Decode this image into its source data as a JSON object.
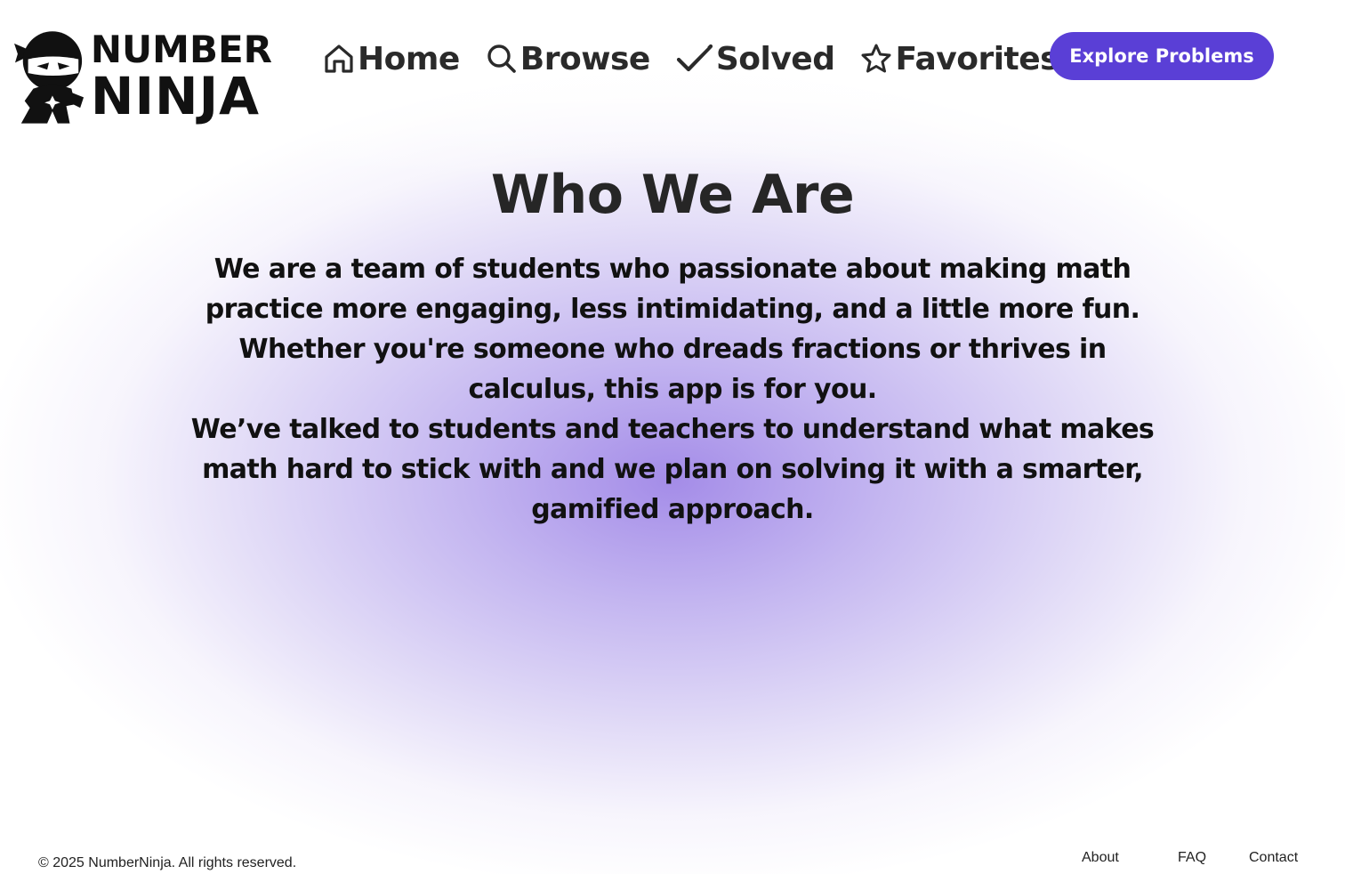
{
  "brand": {
    "logo_line1": "NUMBER",
    "logo_line2": "NINJA",
    "logo_icon": "ninja-mascot-icon"
  },
  "nav": {
    "items": [
      {
        "label": "Home",
        "icon": "home-icon"
      },
      {
        "label": "Browse",
        "icon": "search-icon"
      },
      {
        "label": "Solved",
        "icon": "checkmark-icon"
      },
      {
        "label": "Favorites",
        "icon": "star-icon"
      }
    ],
    "cta_label": "Explore Problems"
  },
  "main": {
    "title": "Who We Are",
    "paragraphs": [
      "We are a team of students who passionate about making math practice more engaging, less intimidating, and a little more fun. Whether you're someone who dreads fractions or thrives in calculus, this app is for you.",
      "We’ve talked to students and teachers to understand what makes math hard to stick with and we plan on solving it with a smarter, gamified approach."
    ]
  },
  "footer": {
    "copyright": "© 2025 NumberNinja. All rights reserved.",
    "links": [
      "About",
      "FAQ",
      "Contact"
    ]
  },
  "colors": {
    "accent": "#5a3fd6",
    "glow": "#9478e4",
    "text": "#111111"
  }
}
